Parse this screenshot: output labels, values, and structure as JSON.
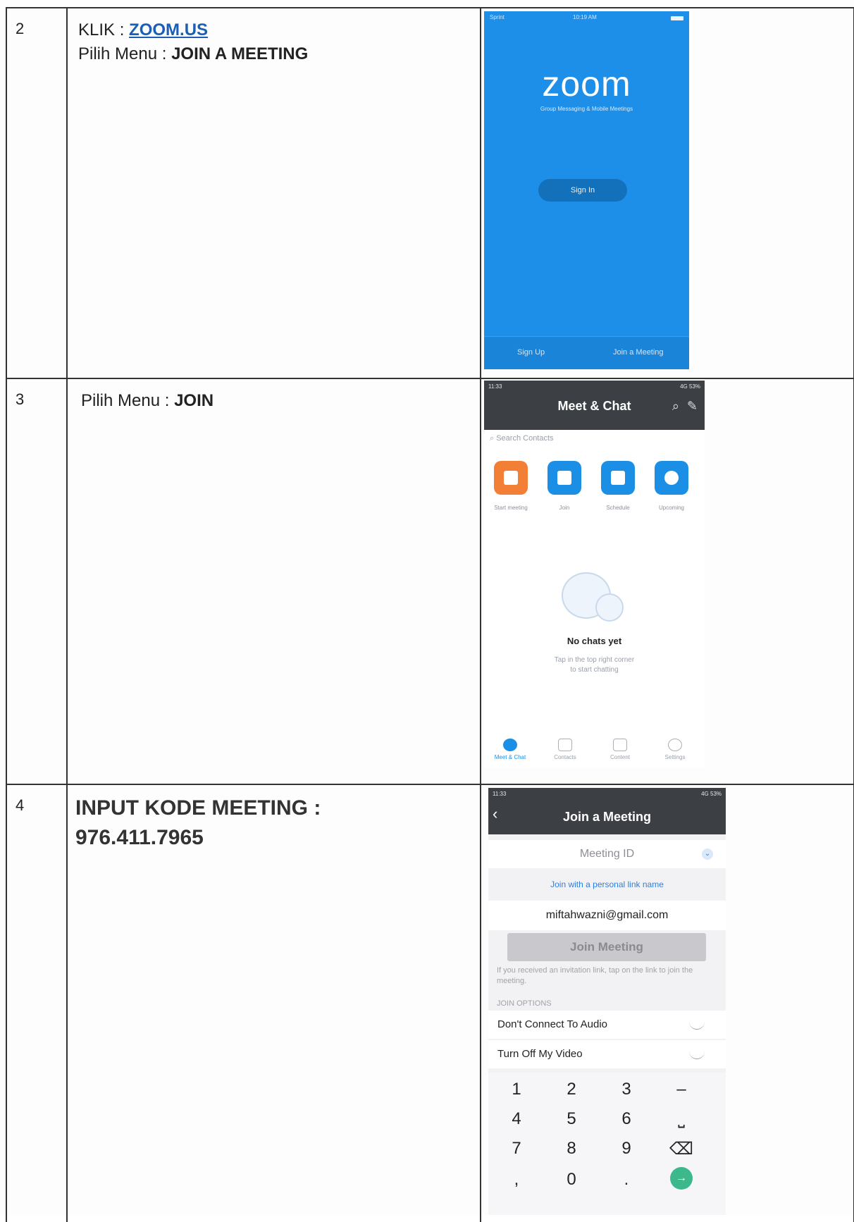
{
  "rows": [
    {
      "num": "2",
      "line1_prefix": "KLIK :  ",
      "line1_link": "ZOOM.US",
      "line2_prefix": "Pilih Menu : ",
      "line2_bold": "JOIN A MEETING"
    },
    {
      "num": "3",
      "line1_prefix": "Pilih Menu : ",
      "line1_bold": "JOIN"
    },
    {
      "num": "4",
      "line1": "INPUT KODE MEETING :",
      "line2": "976.411.7965"
    }
  ],
  "shot1": {
    "status_left": "Sprint",
    "status_time": "10:19 AM",
    "logo": "zoom",
    "tagline": "Group Messaging & Mobile Meetings",
    "signin": "Sign In",
    "signup": "Sign Up",
    "join": "Join a Meeting",
    "bg_color": "#1e8fe8"
  },
  "shot2": {
    "status_time": "11:33",
    "status_right": "4G 53%",
    "title": "Meet & Chat",
    "search_placeholder": "Search Contacts",
    "tiles": [
      "Start meeting",
      "Join",
      "Schedule",
      "Upcoming"
    ],
    "empty_title": "No chats yet",
    "hint_line1": "Tap  in the top right corner",
    "hint_line2": "to start chatting",
    "tabs": [
      "Meet & Chat",
      "Contacts",
      "Content",
      "Settings"
    ],
    "accent": "#1b8fe5",
    "header_color": "#3c4045"
  },
  "shot3": {
    "status_time": "11:33",
    "status_right": "4G 53%",
    "title": "Join a Meeting",
    "meeting_id_placeholder": "Meeting ID",
    "personal_link": "Join with a personal link name",
    "email": "miftahwazni@gmail.com",
    "join_button": "Join Meeting",
    "note": "If you received an invitation link, tap on the link to join the meeting.",
    "options_header": "JOIN OPTIONS",
    "option1": "Don't Connect To Audio",
    "option2": "Turn Off My Video",
    "keys": [
      "1",
      "2",
      "3",
      "–",
      "4",
      "5",
      "6",
      "⎵",
      "7",
      "8",
      "9",
      "⌫",
      ",",
      "0",
      ".",
      "→"
    ]
  }
}
